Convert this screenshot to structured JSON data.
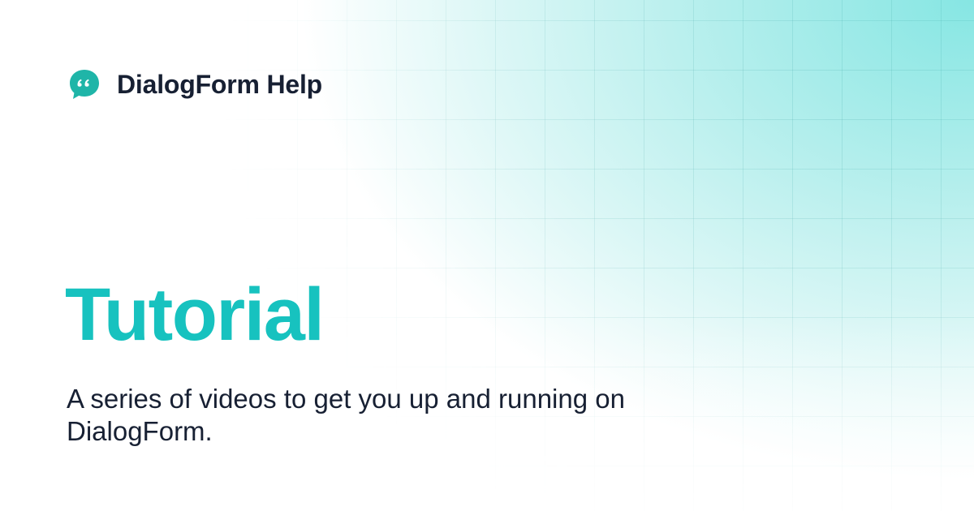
{
  "brand": {
    "name": "DialogForm Help",
    "logo_icon": "speech-bubble-quote-icon",
    "logo_color": "#1fb5a8"
  },
  "hero": {
    "title": "Tutorial",
    "subtitle": "A series of videos to get you up and running on DialogForm."
  },
  "colors": {
    "accent": "#17c2bf",
    "text": "#172033",
    "background_tint": "#86e6e3"
  }
}
